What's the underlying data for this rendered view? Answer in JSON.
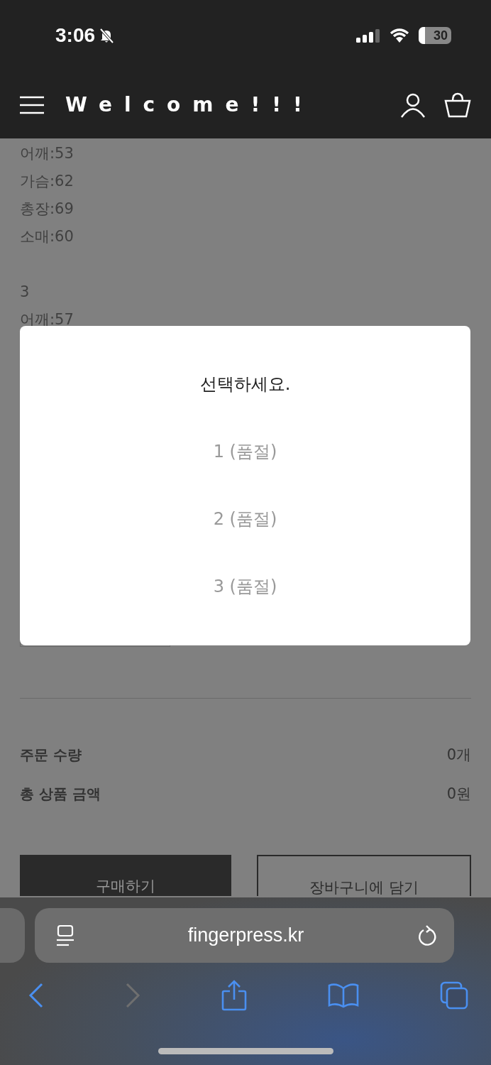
{
  "status_bar": {
    "time": "3:06",
    "battery": "30"
  },
  "header": {
    "title": "Welcome!!!"
  },
  "size_groups": [
    {
      "lines": [
        "어깨:53",
        "가슴:62",
        "총장:69",
        "소매:60"
      ]
    },
    {
      "lines": [
        "3",
        "어깨:57"
      ]
    }
  ],
  "summary": [
    {
      "label": "주문 수량",
      "value": "0개"
    },
    {
      "label": "총 상품 금액",
      "value": "0원"
    }
  ],
  "buttons": [
    {
      "label": "구매하기",
      "kind": "primary"
    },
    {
      "label": "장바구니에 담기",
      "kind": "outline"
    }
  ],
  "modal": {
    "title": "선택하세요.",
    "options": [
      {
        "label": "1 (품절)",
        "disabled": true
      },
      {
        "label": "2 (품절)",
        "disabled": true
      },
      {
        "label": "3 (품절)",
        "disabled": true
      }
    ]
  },
  "browser": {
    "url": "fingerpress.kr",
    "toolbar": [
      {
        "kind": "back",
        "disabled": false
      },
      {
        "kind": "forward",
        "disabled": true
      },
      {
        "kind": "share",
        "disabled": false
      },
      {
        "kind": "bookmarks",
        "disabled": false
      },
      {
        "kind": "tabs",
        "disabled": false
      }
    ]
  }
}
